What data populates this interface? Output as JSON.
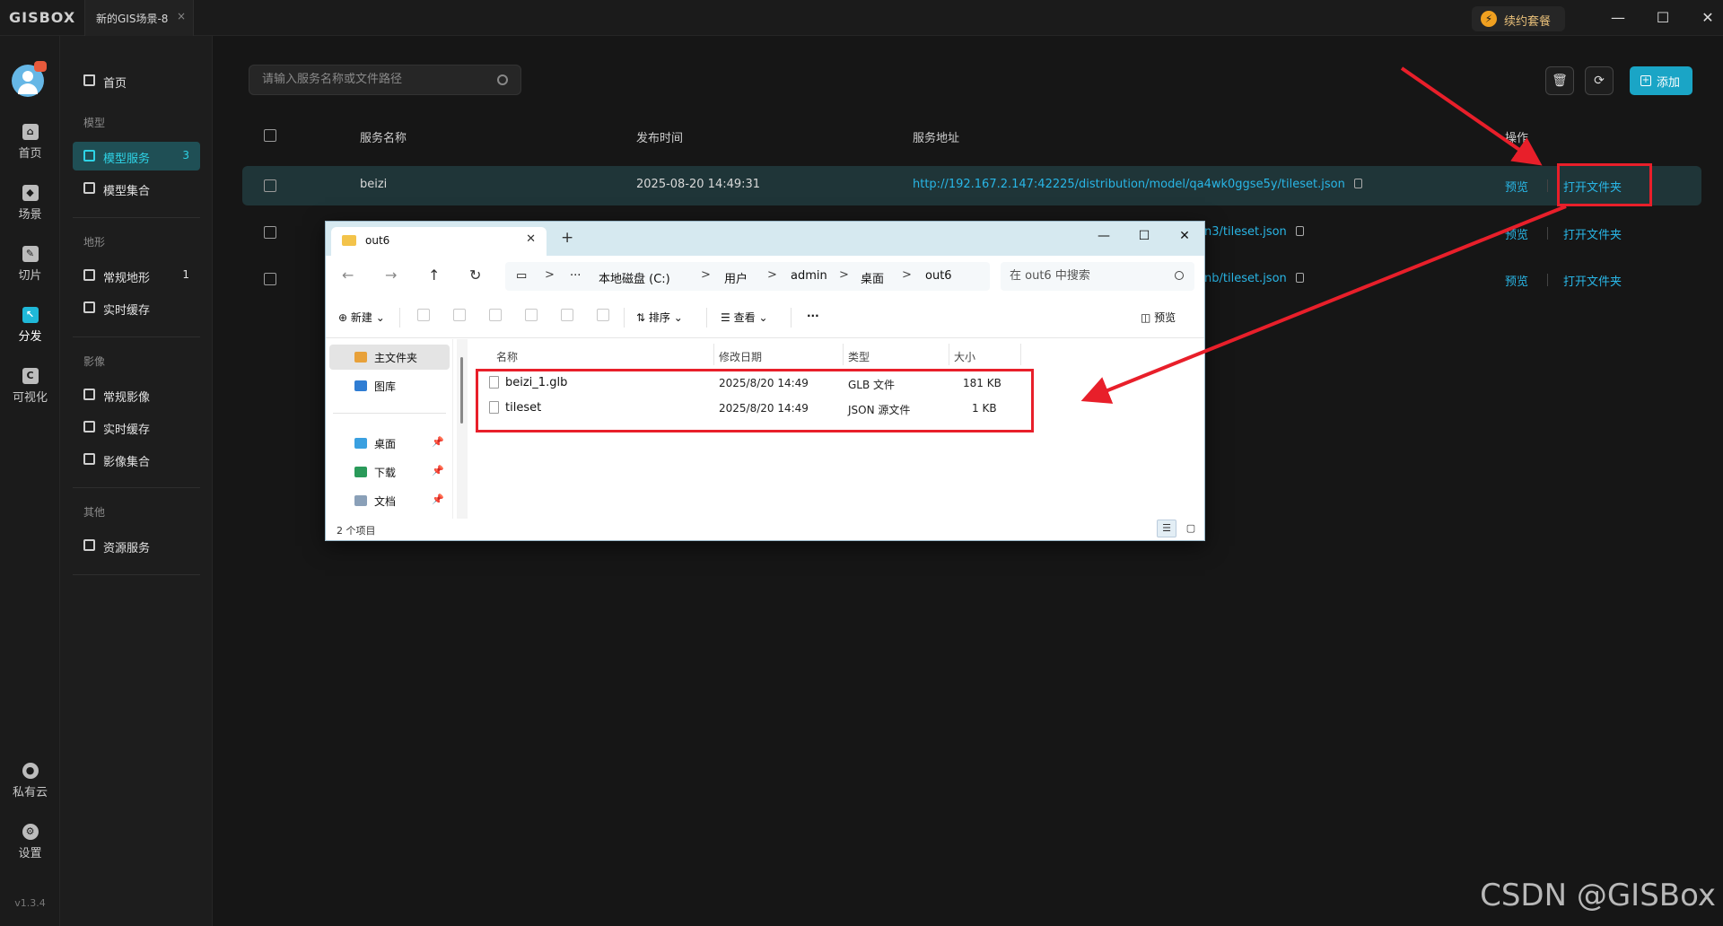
{
  "titlebar": {
    "logo": "GISBOX",
    "tab_title": "新的GIS场景-8",
    "tab_close": "×",
    "renew_icon": "⚡",
    "renew_label": "续约套餐",
    "minimize": "—",
    "maximize": "☐",
    "close": "✕"
  },
  "rail": {
    "items": [
      {
        "icon": "home-icon",
        "glyph": "⌂",
        "label": "首页"
      },
      {
        "icon": "scene-icon",
        "glyph": "◆",
        "label": "场景"
      },
      {
        "icon": "tile-icon",
        "glyph": "✎",
        "label": "切片"
      },
      {
        "icon": "distribute-icon",
        "glyph": "↖",
        "label": "分发"
      },
      {
        "icon": "visualize-icon",
        "glyph": "C",
        "label": "可视化"
      },
      {
        "icon": "private-cloud-icon",
        "glyph": "●",
        "label": "私有云"
      },
      {
        "icon": "settings-icon",
        "glyph": "⚙",
        "label": "设置"
      }
    ],
    "active_index": 3,
    "version": "v1.3.4"
  },
  "nav": {
    "home": "首页",
    "groups": [
      {
        "title": "模型",
        "items": [
          {
            "label": "模型服务",
            "count": "3"
          },
          {
            "label": "模型集合",
            "count": ""
          }
        ]
      },
      {
        "title": "地形",
        "items": [
          {
            "label": "常规地形",
            "count": "1"
          },
          {
            "label": "实时缓存",
            "count": ""
          }
        ]
      },
      {
        "title": "影像",
        "items": [
          {
            "label": "常规影像",
            "count": ""
          },
          {
            "label": "实时缓存",
            "count": ""
          },
          {
            "label": "影像集合",
            "count": ""
          }
        ]
      },
      {
        "title": "其他",
        "items": [
          {
            "label": "资源服务",
            "count": ""
          }
        ]
      }
    ]
  },
  "main": {
    "search_placeholder": "请输入服务名称或文件路径",
    "delete_icon": "🗑",
    "refresh_icon": "⟳",
    "add_label": "添加",
    "add_icon": "+",
    "headers": {
      "name": "服务名称",
      "time": "发布时间",
      "url": "服务地址",
      "ops": "操作"
    },
    "rows": [
      {
        "name": "beizi",
        "time": "2025-08-20 14:49:31",
        "url": "http://192.167.2.147:42225/distribution/model/qa4wk0ggse5y/tileset.json",
        "preview": "预览",
        "open": "打开文件夹"
      },
      {
        "name": "",
        "time": "",
        "url": "n3/tileset.json",
        "preview": "预览",
        "open": "打开文件夹"
      },
      {
        "name": "",
        "time": "",
        "url": "nb/tileset.json",
        "preview": "预览",
        "open": "打开文件夹"
      }
    ]
  },
  "explorer": {
    "tab_title": "out6",
    "tab_close": "✕",
    "new_tab": "+",
    "win_min": "—",
    "win_max": "☐",
    "win_close": "✕",
    "nav_back": "←",
    "nav_forward": "→",
    "nav_up": "↑",
    "nav_refresh": "↻",
    "monitor_icon": "▭",
    "ellipsis": "···",
    "breadcrumbs": [
      "本地磁盘 (C:)",
      "用户",
      "admin",
      "桌面",
      "out6"
    ],
    "crumb_sep": ">",
    "search_placeholder": "在 out6 中搜索",
    "commands": {
      "new": "新建",
      "sort": "排序",
      "view": "查看",
      "more": "···",
      "preview": "预览"
    },
    "command_icons": {
      "new": "⊕",
      "sort": "⇅",
      "view": "☰",
      "preview": "◫",
      "caret": "⌄"
    },
    "sidebar": [
      {
        "label": "主文件夹",
        "pinned": false,
        "color": "#e8a13a"
      },
      {
        "label": "图库",
        "pinned": false,
        "color": "#2f7dd3"
      },
      {
        "label": "桌面",
        "pinned": true,
        "color": "#3aa0e0"
      },
      {
        "label": "下载",
        "pinned": true,
        "color": "#2a9a5a"
      },
      {
        "label": "文档",
        "pinned": true,
        "color": "#8aa0b8"
      }
    ],
    "pin_glyph": "📌",
    "columns": {
      "name": "名称",
      "date": "修改日期",
      "type": "类型",
      "size": "大小"
    },
    "files": [
      {
        "name": "beizi_1.glb",
        "date": "2025/8/20 14:49",
        "type": "GLB 文件",
        "size": "181 KB"
      },
      {
        "name": "tileset",
        "date": "2025/8/20 14:49",
        "type": "JSON 源文件",
        "size": "1 KB"
      }
    ],
    "status": "2 个项目",
    "view_details": "☰",
    "view_tiles": "▢"
  },
  "watermark": "CSDN @GISBox",
  "colors": {
    "accent": "#1aa5c6",
    "link": "#29b6e6",
    "highlight": "#e81f2a"
  }
}
